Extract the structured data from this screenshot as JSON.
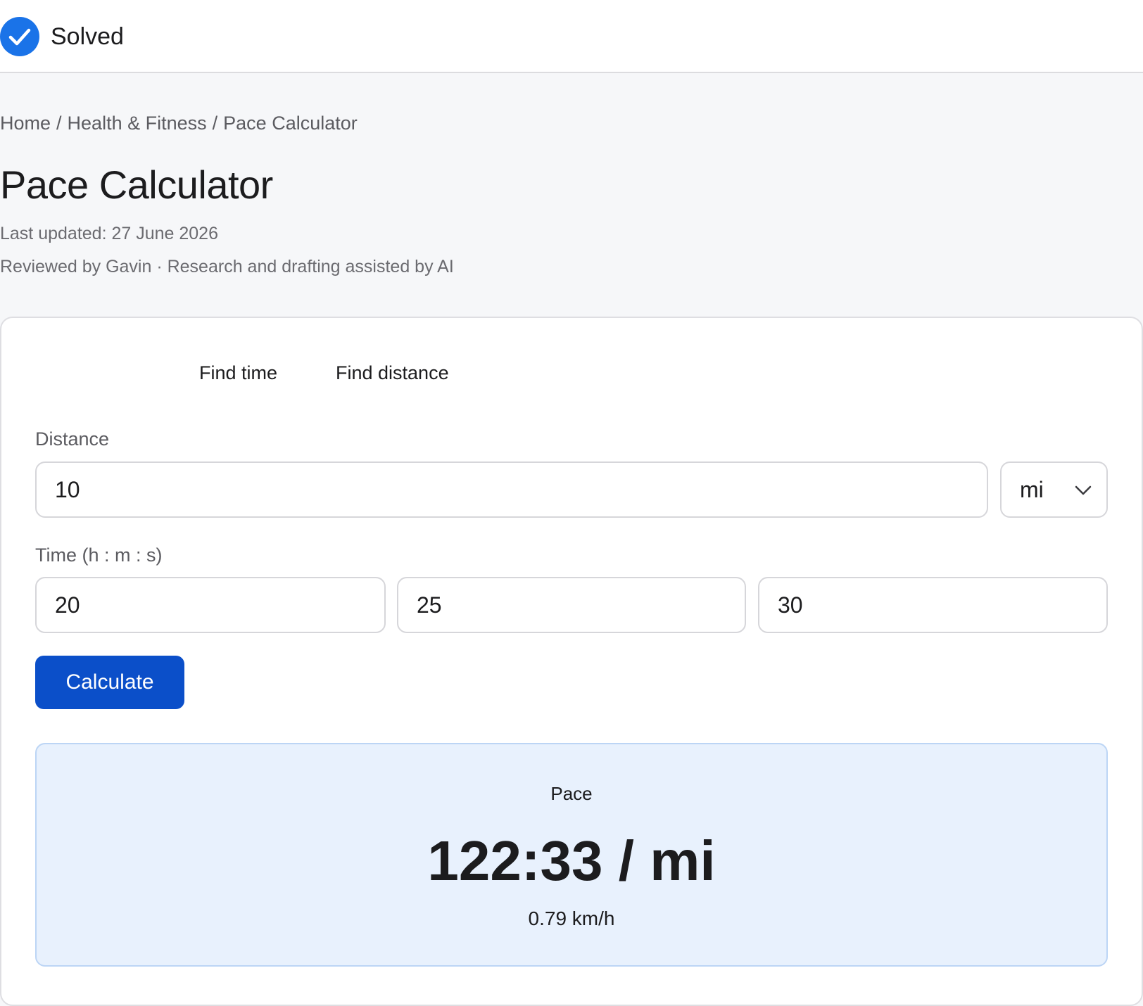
{
  "status": {
    "label": "Solved",
    "icon": "check-circle-icon",
    "color": "#1a73e8"
  },
  "breadcrumb": {
    "items": [
      "Home",
      "Health & Fitness",
      "Pace Calculator"
    ],
    "separator": "/"
  },
  "page": {
    "title": "Pace Calculator",
    "last_updated": "Last updated: 27 June 2026",
    "reviewed": "Reviewed by Gavin · Research and drafting assisted by AI"
  },
  "tabs": [
    {
      "label": "Find time"
    },
    {
      "label": "Find distance"
    }
  ],
  "form": {
    "distance_label": "Distance",
    "distance_value": "10",
    "unit_selected": "mi",
    "time_label": "Time (h : m : s)",
    "hours_value": "20",
    "minutes_value": "25",
    "seconds_value": "30",
    "calculate_label": "Calculate"
  },
  "result": {
    "label": "Pace",
    "value": "122:33 / mi",
    "speed": "0.79 km/h"
  },
  "colors": {
    "primary": "#0b4fc9",
    "result_bg": "#e8f1fd",
    "result_border": "#bcd5f5"
  }
}
